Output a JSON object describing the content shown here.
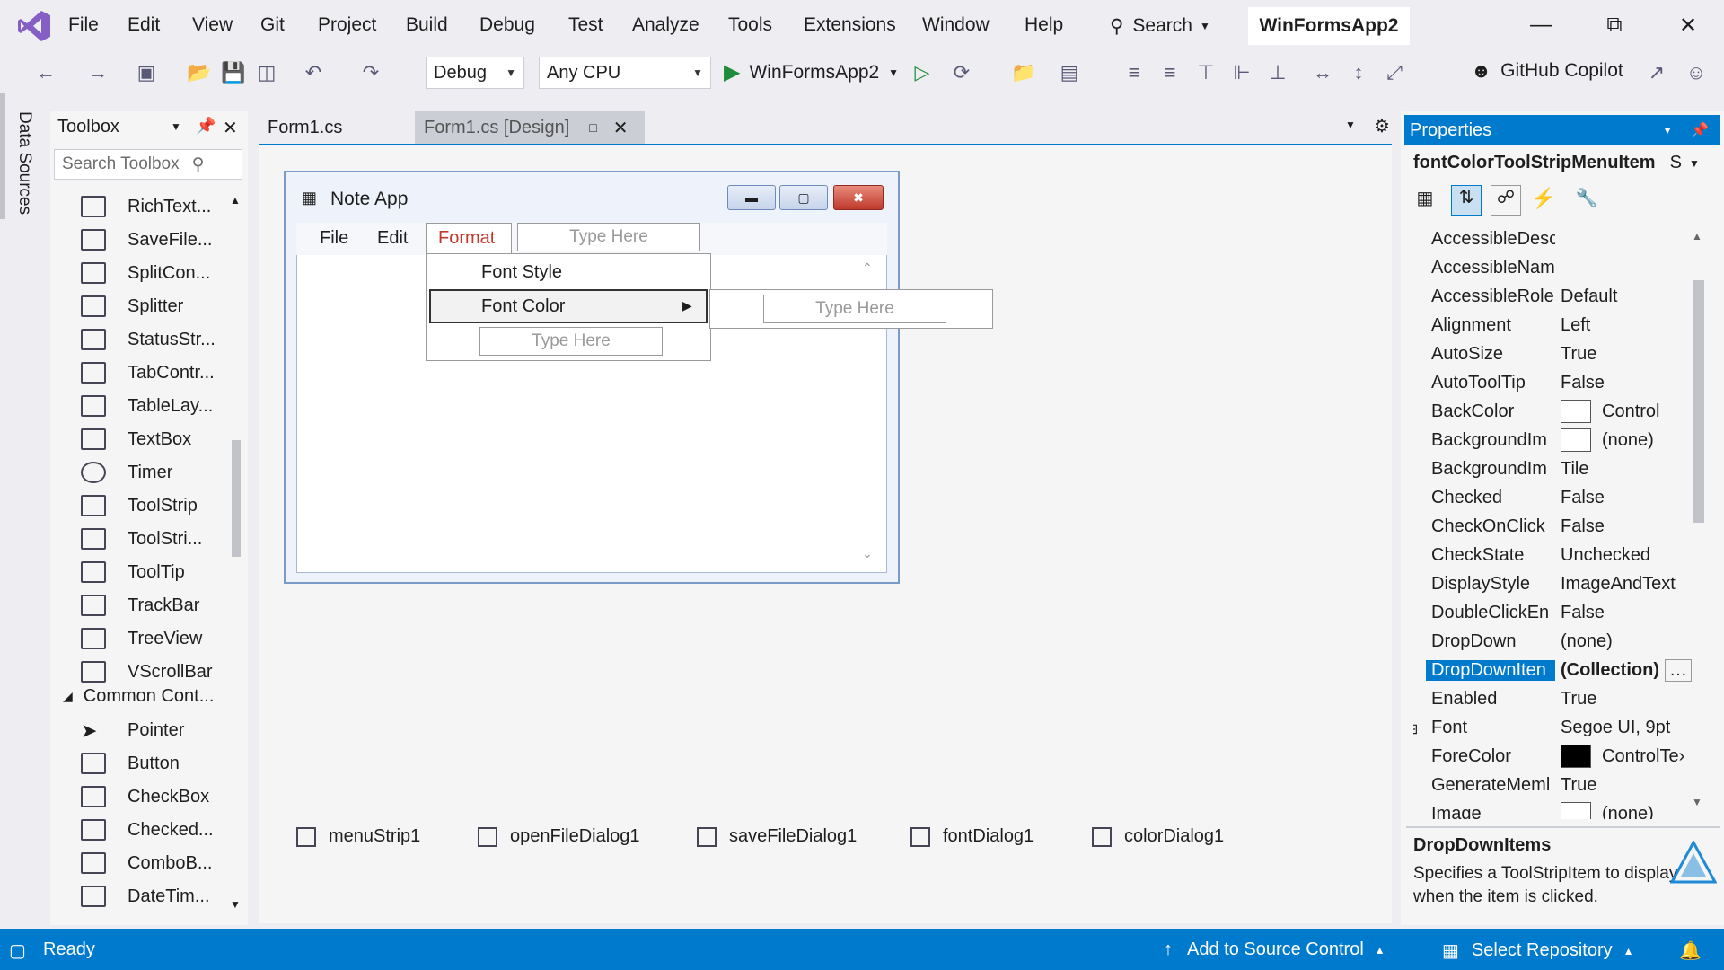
{
  "menubar": {
    "items": [
      "File",
      "Edit",
      "View",
      "Git",
      "Project",
      "Build",
      "Debug",
      "Test",
      "Analyze",
      "Tools",
      "Extensions",
      "Window",
      "Help"
    ],
    "search_label": "Search",
    "solution_title": "WinFormsApp2"
  },
  "toolbar": {
    "config": "Debug",
    "platform": "Any CPU",
    "start_target": "WinFormsApp2",
    "copilot_label": "GitHub Copilot"
  },
  "left_strip": {
    "label": "Data Sources"
  },
  "toolbox": {
    "title": "Toolbox",
    "search_placeholder": "Search Toolbox",
    "items": [
      "RichText...",
      "SaveFile...",
      "SplitCon...",
      "Splitter",
      "StatusStr...",
      "TabContr...",
      "TableLay...",
      "TextBox",
      "Timer",
      "ToolStrip",
      "ToolStri...",
      "ToolTip",
      "TrackBar",
      "TreeView",
      "VScrollBar"
    ],
    "group_label": "Common Cont...",
    "group_items": [
      "Pointer",
      "Button",
      "CheckBox",
      "Checked...",
      "ComboB...",
      "DateTim..."
    ]
  },
  "doc_tabs": [
    {
      "label": "Form1.cs"
    },
    {
      "label": "Form1.cs [Design]"
    }
  ],
  "form": {
    "title": "Note App",
    "menu": [
      "File",
      "Edit",
      "Format"
    ],
    "type_here": "Type Here",
    "dropdown": [
      "Font Style",
      "Font Color"
    ]
  },
  "tray": [
    "menuStrip1",
    "openFileDialog1",
    "saveFileDialog1",
    "fontDialog1",
    "colorDialog1"
  ],
  "properties": {
    "title": "Properties",
    "object": "fontColorToolStripMenuItem",
    "object_suffix": "S",
    "rows": [
      {
        "name": "AccessibleDesc",
        "value": ""
      },
      {
        "name": "AccessibleNam",
        "value": ""
      },
      {
        "name": "AccessibleRole",
        "value": "Default"
      },
      {
        "name": "Alignment",
        "value": "Left"
      },
      {
        "name": "AutoSize",
        "value": "True"
      },
      {
        "name": "AutoToolTip",
        "value": "False"
      },
      {
        "name": "BackColor",
        "value": "Control",
        "swatch": "#ffffff"
      },
      {
        "name": "BackgroundIm",
        "value": "(none)",
        "swatch": "#ffffff"
      },
      {
        "name": "BackgroundIm",
        "value": "Tile"
      },
      {
        "name": "Checked",
        "value": "False"
      },
      {
        "name": "CheckOnClick",
        "value": "False"
      },
      {
        "name": "CheckState",
        "value": "Unchecked"
      },
      {
        "name": "DisplayStyle",
        "value": "ImageAndText"
      },
      {
        "name": "DoubleClickEn",
        "value": "False"
      },
      {
        "name": "DropDown",
        "value": "(none)"
      },
      {
        "name": "DropDownIten",
        "value": "(Collection)",
        "selected": true
      },
      {
        "name": "Enabled",
        "value": "True"
      },
      {
        "name": "Font",
        "value": "Segoe UI, 9pt"
      },
      {
        "name": "ForeColor",
        "value": "ControlTe›",
        "swatch": "#000000"
      },
      {
        "name": "GenerateMeml",
        "value": "True"
      },
      {
        "name": "Image",
        "value": "(none)"
      }
    ],
    "desc_title": "DropDownItems",
    "desc_text": "Specifies a ToolStripItem to display when the item is clicked."
  },
  "statusbar": {
    "ready": "Ready",
    "source_control": "Add to Source Control",
    "repository": "Select Repository"
  },
  "colors": {
    "accent": "#007acc",
    "vs_purple": "#865fc5"
  }
}
